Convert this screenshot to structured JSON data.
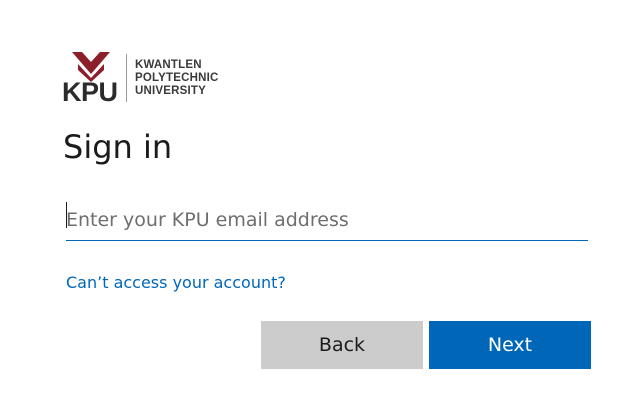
{
  "brand": {
    "logo_abbr": "KPU",
    "logo_lines": [
      "KWANTLEN",
      "POLYTECHNIC",
      "UNIVERSITY"
    ],
    "logo_icon": "kpu-chevron-logo-icon",
    "logo_color": "#8b1f2a"
  },
  "signin": {
    "title": "Sign in",
    "email_value": "",
    "email_placeholder": "Enter your KPU email address",
    "help_link": "Can’t access your account?",
    "back_label": "Back",
    "next_label": "Next"
  },
  "colors": {
    "accent": "#0067b8",
    "secondary_button": "#cccccc",
    "text": "#1b1b1b"
  }
}
